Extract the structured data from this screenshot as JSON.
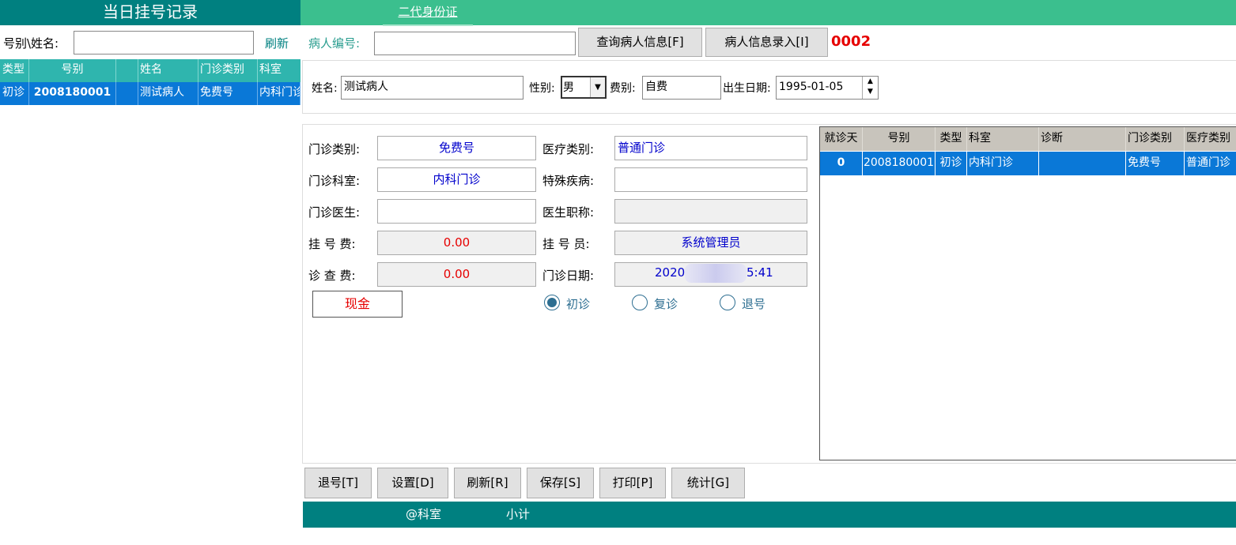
{
  "left_panel": {
    "title": "当日挂号记录",
    "search_label": "号别\\姓名:",
    "search_value": "",
    "refresh": "刷新",
    "columns": [
      "类型",
      "号别",
      "",
      "姓名",
      "门诊类别",
      "科室"
    ],
    "rows": [
      {
        "type": "初诊",
        "number": "2008180001",
        "blank": "",
        "name": "测试病人",
        "clinic_type": "免费号",
        "dept": "内科门诊"
      }
    ]
  },
  "top_bar": {
    "id_card_tab": "二代身份证"
  },
  "patient": {
    "number_label": "病人编号:",
    "number_value": "",
    "query_button": "查询病人信息[F]",
    "entry_button": "病人信息录入[I]",
    "count": "0002",
    "name_label": "姓名:",
    "name_value": "测试病人",
    "gender_label": "性别:",
    "gender_value": "男",
    "fee_type_label": "费别:",
    "fee_type_value": "自费",
    "dob_label": "出生日期:",
    "dob_value": "1995-01-05"
  },
  "form": {
    "clinic_type_label": "门诊类别:",
    "clinic_type_value": "免费号",
    "medical_type_label": "医疗类别:",
    "medical_type_value": "普通门诊",
    "clinic_dept_label": "门诊科室:",
    "clinic_dept_value": "内科门诊",
    "special_disease_label": "特殊疾病:",
    "special_disease_value": "",
    "doctor_label": "门诊医生:",
    "doctor_value": "",
    "doctor_title_label": "医生职称:",
    "doctor_title_value": "",
    "reg_fee_label": "挂 号 费:",
    "reg_fee_value": "0.00",
    "registrar_label": "挂 号 员:",
    "registrar_value": "系统管理员",
    "exam_fee_label": "诊 查 费:",
    "exam_fee_value": "0.00",
    "clinic_date_label": "门诊日期:",
    "clinic_date_value": "2020",
    "clinic_date_suffix": "5:41",
    "cash_button": "现金",
    "radios": [
      {
        "label": "初诊",
        "checked": true
      },
      {
        "label": "复诊",
        "checked": false
      },
      {
        "label": "退号",
        "checked": false
      }
    ]
  },
  "history": {
    "columns": [
      "就诊天",
      "号别",
      "类型",
      "科室",
      "诊断",
      "门诊类别",
      "医疗类别"
    ],
    "rows": [
      {
        "days": "0",
        "number": "2008180001",
        "type": "初诊",
        "dept": "内科门诊",
        "diagnosis": "",
        "clinic_type": "免费号",
        "medical_type": "普通门诊"
      }
    ]
  },
  "bottom": {
    "buttons": [
      "退号[T]",
      "设置[D]",
      "刷新[R]",
      "保存[S]",
      "打印[P]",
      "统计[G]"
    ],
    "status_dept": "@科室",
    "status_subtotal": "小计"
  }
}
